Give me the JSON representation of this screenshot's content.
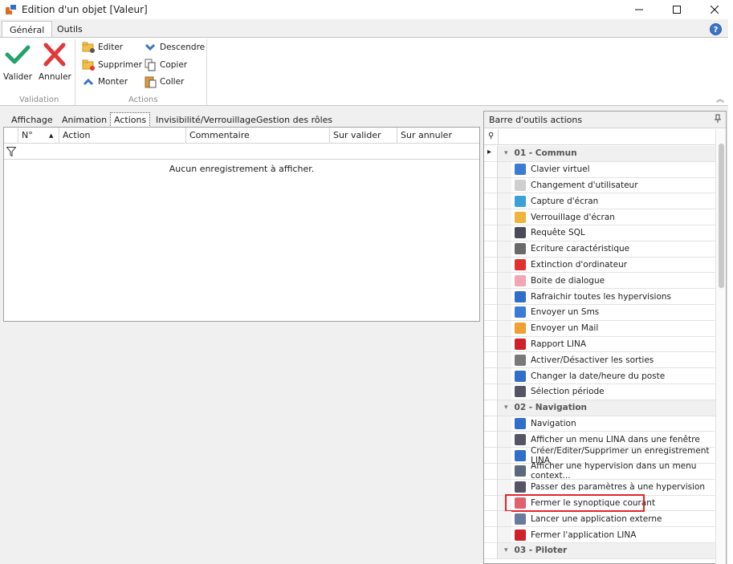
{
  "window": {
    "title": "Edition d'un objet [Valeur]"
  },
  "ribbon_tabs": [
    "Général",
    "Outils"
  ],
  "ribbon": {
    "validation": {
      "label": "Validation",
      "valider": "Valider",
      "annuler": "Annuler"
    },
    "actions": {
      "label": "Actions",
      "editer": "Editer",
      "supprimer": "Supprimer",
      "monter": "Monter",
      "descendre": "Descendre",
      "copier": "Copier",
      "coller": "Coller"
    }
  },
  "left_tabs": [
    "Affichage",
    "Animation",
    "Actions",
    "Invisibilité/Verrouillage",
    "Gestion des rôles"
  ],
  "grid": {
    "columns": [
      "N°",
      "Action",
      "Commentaire",
      "Sur valider",
      "Sur annuler"
    ],
    "empty_message": "Aucun enregistrement à afficher."
  },
  "toolbar_panel": {
    "title": "Barre d'outils actions",
    "rows": [
      {
        "type": "group",
        "label": "01 - Commun"
      },
      {
        "type": "item",
        "label": "Clavier virtuel",
        "icon": "keyboard-icon",
        "color": "#3a7bd5"
      },
      {
        "type": "item",
        "label": "Changement d'utilisateur",
        "icon": "user-switch-icon",
        "color": "#cfcfcf"
      },
      {
        "type": "item",
        "label": "Capture d'écran",
        "icon": "screenshot-icon",
        "color": "#3ca0d8"
      },
      {
        "type": "item",
        "label": "Verrouillage d'écran",
        "icon": "lock-screen-icon",
        "color": "#f0b33c"
      },
      {
        "type": "item",
        "label": "Requête SQL",
        "icon": "sql-icon",
        "color": "#4a4a5a"
      },
      {
        "type": "item",
        "label": "Ecriture caractéristique",
        "icon": "table-write-icon",
        "color": "#6a6a6a"
      },
      {
        "type": "item",
        "label": "Extinction d'ordinateur",
        "icon": "power-icon",
        "color": "#e03030"
      },
      {
        "type": "item",
        "label": "Boite de dialogue",
        "icon": "dialog-icon",
        "color": "#f2a6b4"
      },
      {
        "type": "item",
        "label": "Rafraichir toutes les hypervisions",
        "icon": "refresh-icon",
        "color": "#2f6fc9"
      },
      {
        "type": "item",
        "label": "Envoyer un Sms",
        "icon": "sms-icon",
        "color": "#3a7bd5"
      },
      {
        "type": "item",
        "label": "Envoyer un Mail",
        "icon": "mail-icon",
        "color": "#f0a030"
      },
      {
        "type": "item",
        "label": "Rapport LINA",
        "icon": "report-icon",
        "color": "#d0202a"
      },
      {
        "type": "item",
        "label": "Activer/Désactiver les sorties",
        "icon": "gear-icon",
        "color": "#7a7a7a"
      },
      {
        "type": "item",
        "label": "Changer la date/heure du poste",
        "icon": "clock-icon",
        "color": "#2f6fc9"
      },
      {
        "type": "item",
        "label": "Sélection période",
        "icon": "tools-icon",
        "color": "#555566"
      },
      {
        "type": "group",
        "label": "02 - Navigation"
      },
      {
        "type": "item",
        "label": "Navigation",
        "icon": "arrow-right-icon",
        "color": "#2f6fc9"
      },
      {
        "type": "item",
        "label": "Afficher un menu LINA dans une fenêtre",
        "icon": "tools-icon",
        "color": "#555566"
      },
      {
        "type": "item",
        "label": "Créer/Editer/Supprimer un enregistrement LINA",
        "icon": "form-icon",
        "color": "#2f6fc9"
      },
      {
        "type": "item",
        "label": "Afficher une hypervision dans un menu context...",
        "icon": "context-menu-icon",
        "color": "#5a6a7a"
      },
      {
        "type": "item",
        "label": "Passer des paramètres à une hypervision",
        "icon": "tools-icon",
        "color": "#555566"
      },
      {
        "type": "item",
        "label": "Fermer le synoptique courant",
        "icon": "close-synoptic-icon",
        "color": "#e06070",
        "highlight": true
      },
      {
        "type": "item",
        "label": "Lancer une application externe",
        "icon": "external-app-icon",
        "color": "#6a7a9a"
      },
      {
        "type": "item",
        "label": "Fermer l'application LINA",
        "icon": "exit-icon",
        "color": "#d0202a"
      },
      {
        "type": "group",
        "label": "03 - Piloter"
      }
    ]
  }
}
